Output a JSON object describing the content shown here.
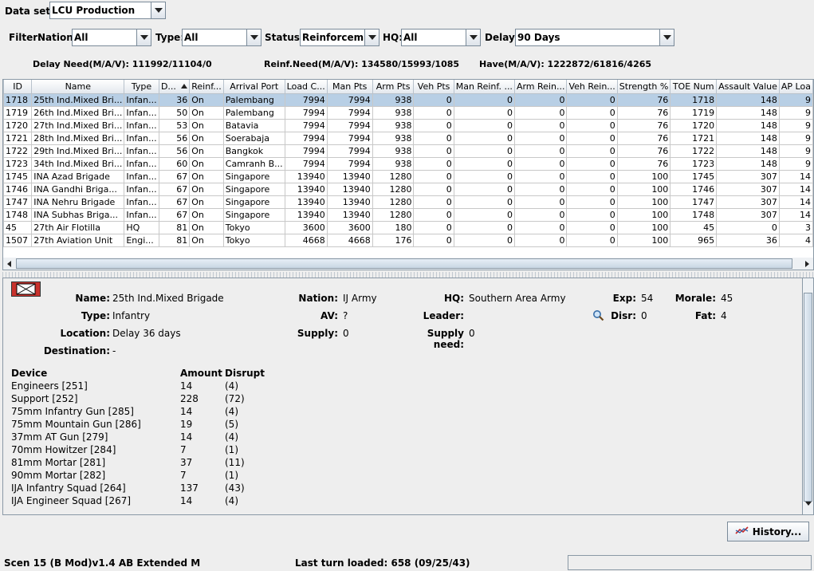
{
  "dataset": {
    "label": "Data set:",
    "value": "LCU Production"
  },
  "filters": {
    "label": "Filter:",
    "nation": {
      "label": "Nation:",
      "value": "All"
    },
    "type": {
      "label": "Type:",
      "value": "All"
    },
    "status": {
      "label": "Status:",
      "value": "Reinforcem..."
    },
    "hq": {
      "label": "HQ:",
      "value": "All"
    },
    "delay": {
      "label": "Delay:",
      "value": "90 Days"
    }
  },
  "stats": {
    "delay_need": "Delay Need(M/A/V): 111992/11104/0",
    "reinf_need": "Reinf.Need(M/A/V): 134580/15993/1085",
    "have": "Have(M/A/V): 1222872/61816/4265"
  },
  "table": {
    "headers": [
      "ID",
      "Name",
      "Type",
      "D...",
      "Reinf...",
      "Arrival Port",
      "Load C...",
      "Man Pts",
      "Arm Pts",
      "Veh Pts",
      "Man Reinf. ...",
      "Arm Rein...",
      "Veh Rein...",
      "Strength %",
      "TOE Num",
      "Assault Value",
      "AP Loa"
    ],
    "rows": [
      [
        "1718",
        "25th Ind.Mixed Bri...",
        "Infan...",
        "36",
        "On",
        "Palembang",
        "7994",
        "7994",
        "938",
        "0",
        "0",
        "0",
        "0",
        "76",
        "1718",
        "148",
        "9"
      ],
      [
        "1719",
        "26th Ind.Mixed Bri...",
        "Infan...",
        "50",
        "On",
        "Palembang",
        "7994",
        "7994",
        "938",
        "0",
        "0",
        "0",
        "0",
        "76",
        "1719",
        "148",
        "9"
      ],
      [
        "1720",
        "27th Ind.Mixed Bri...",
        "Infan...",
        "53",
        "On",
        "Batavia",
        "7994",
        "7994",
        "938",
        "0",
        "0",
        "0",
        "0",
        "76",
        "1720",
        "148",
        "9"
      ],
      [
        "1721",
        "28th Ind.Mixed Bri...",
        "Infan...",
        "56",
        "On",
        "Soerabaja",
        "7994",
        "7994",
        "938",
        "0",
        "0",
        "0",
        "0",
        "76",
        "1721",
        "148",
        "9"
      ],
      [
        "1722",
        "29th Ind.Mixed Bri...",
        "Infan...",
        "56",
        "On",
        "Bangkok",
        "7994",
        "7994",
        "938",
        "0",
        "0",
        "0",
        "0",
        "76",
        "1722",
        "148",
        "9"
      ],
      [
        "1723",
        "34th Ind.Mixed Bri...",
        "Infan...",
        "60",
        "On",
        "Camranh B...",
        "7994",
        "7994",
        "938",
        "0",
        "0",
        "0",
        "0",
        "76",
        "1723",
        "148",
        "9"
      ],
      [
        "1745",
        "INA Azad Brigade",
        "Infan...",
        "67",
        "On",
        "Singapore",
        "13940",
        "13940",
        "1280",
        "0",
        "0",
        "0",
        "0",
        "100",
        "1745",
        "307",
        "14"
      ],
      [
        "1746",
        "INA Gandhi Briga...",
        "Infan...",
        "67",
        "On",
        "Singapore",
        "13940",
        "13940",
        "1280",
        "0",
        "0",
        "0",
        "0",
        "100",
        "1746",
        "307",
        "14"
      ],
      [
        "1747",
        "INA Nehru Brigade",
        "Infan...",
        "67",
        "On",
        "Singapore",
        "13940",
        "13940",
        "1280",
        "0",
        "0",
        "0",
        "0",
        "100",
        "1747",
        "307",
        "14"
      ],
      [
        "1748",
        "INA Subhas Briga...",
        "Infan...",
        "67",
        "On",
        "Singapore",
        "13940",
        "13940",
        "1280",
        "0",
        "0",
        "0",
        "0",
        "100",
        "1748",
        "307",
        "14"
      ],
      [
        "45",
        "27th Air Flotilla",
        "HQ",
        "81",
        "On",
        "Tokyo",
        "3600",
        "3600",
        "180",
        "0",
        "0",
        "0",
        "0",
        "100",
        "45",
        "0",
        "3"
      ],
      [
        "1507",
        "27th Aviation Unit",
        "Engi...",
        "81",
        "On",
        "Tokyo",
        "4668",
        "4668",
        "176",
        "0",
        "0",
        "0",
        "0",
        "100",
        "965",
        "36",
        "4"
      ]
    ]
  },
  "detail": {
    "name": {
      "label": "Name:",
      "value": "25th Ind.Mixed Brigade"
    },
    "type": {
      "label": "Type:",
      "value": "Infantry"
    },
    "location": {
      "label": "Location:",
      "value": "Delay 36 days"
    },
    "destination": {
      "label": "Destination:",
      "value": "-"
    },
    "nation": {
      "label": "Nation:",
      "value": "IJ Army"
    },
    "av": {
      "label": "AV:",
      "value": "?"
    },
    "supply": {
      "label": "Supply:",
      "value": "0"
    },
    "hq": {
      "label": "HQ:",
      "value": "Southern Area Army"
    },
    "leader": {
      "label": "Leader:",
      "value": ""
    },
    "supply_need": {
      "label": "Supply need:",
      "value": "0"
    },
    "exp": {
      "label": "Exp:",
      "value": "54"
    },
    "disr": {
      "label": "Disr:",
      "value": "0"
    },
    "morale": {
      "label": "Morale:",
      "value": "45"
    },
    "fat": {
      "label": "Fat:",
      "value": "4"
    },
    "devices_header": {
      "device": "Device",
      "amount": "Amount",
      "disrupt": "Disrupt"
    },
    "devices": [
      {
        "device": "Engineers [251]",
        "amount": "14",
        "disrupt": "(4)"
      },
      {
        "device": "Support [252]",
        "amount": "228",
        "disrupt": "(72)"
      },
      {
        "device": "75mm Infantry Gun [285]",
        "amount": "14",
        "disrupt": "(4)"
      },
      {
        "device": "75mm Mountain Gun [286]",
        "amount": "19",
        "disrupt": "(5)"
      },
      {
        "device": "37mm AT Gun [279]",
        "amount": "14",
        "disrupt": "(4)"
      },
      {
        "device": "70mm Howitzer [284]",
        "amount": "7",
        "disrupt": "(1)"
      },
      {
        "device": "81mm Mortar [281]",
        "amount": "37",
        "disrupt": "(11)"
      },
      {
        "device": "90mm Mortar [282]",
        "amount": "7",
        "disrupt": "(1)"
      },
      {
        "device": "IJA Infantry Squad [264]",
        "amount": "137",
        "disrupt": "(43)"
      },
      {
        "device": "IJA Engineer Squad [267]",
        "amount": "14",
        "disrupt": "(4)"
      }
    ]
  },
  "history_button": "History...",
  "status": {
    "scenario": "Scen 15 (B Mod)v1.4 AB Extended M",
    "last_turn": "Last turn loaded: 658 (09/25/43)"
  },
  "colors": {
    "selected_row": "#b8cfe5",
    "unit_icon": "#c8322c"
  }
}
